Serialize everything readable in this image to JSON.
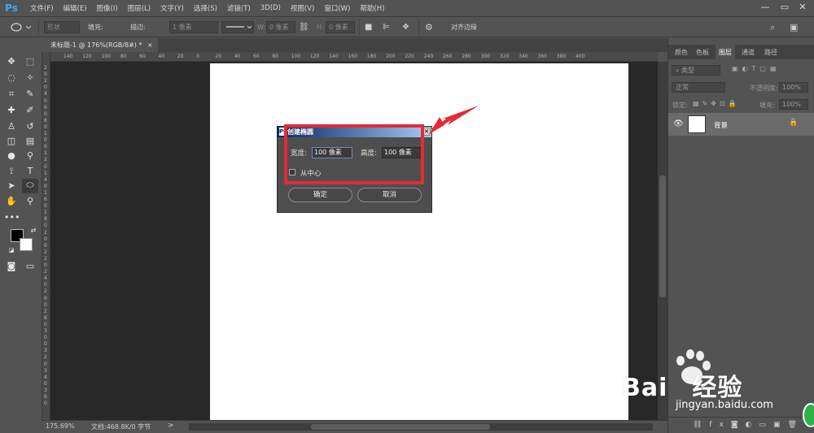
{
  "app": {
    "logo": "Ps"
  },
  "menu": [
    "文件(F)",
    "编辑(E)",
    "图像(I)",
    "图层(L)",
    "文字(Y)",
    "选择(S)",
    "滤镜(T)",
    "3D(D)",
    "视图(V)",
    "窗口(W)",
    "帮助(H)"
  ],
  "window_controls": {
    "minimize": "—",
    "restore": "▭",
    "close": "✕"
  },
  "options": {
    "mode": "形状",
    "fill_label": "填充:",
    "stroke_label": "描边:",
    "stroke_width": "1 像素",
    "w_label": "W:",
    "w_value": "0 像素",
    "h_label": "H:",
    "h_value": "0 像素",
    "align_edges": "对齐边缘"
  },
  "document": {
    "tab_title": "未标题-1 @ 176%(RGB/8#) *",
    "close_glyph": "×"
  },
  "ruler": {
    "h_ticks": [
      "140",
      "120",
      "100",
      "80",
      "60",
      "40",
      "20",
      "0",
      "20",
      "40",
      "60",
      "80",
      "100",
      "120",
      "140",
      "160",
      "180",
      "200",
      "220",
      "240",
      "260",
      "280",
      "300",
      "320",
      "340",
      "360",
      "380",
      "400"
    ],
    "v_ticks": [
      "2",
      "0",
      "2",
      "0",
      "4",
      "0",
      "6",
      "0",
      "8",
      "0",
      "1",
      "0",
      "0",
      "1",
      "2",
      "0",
      "1",
      "4",
      "0",
      "1",
      "6",
      "0",
      "1",
      "8",
      "0",
      "2",
      "0",
      "0",
      "2",
      "2",
      "0",
      "2",
      "4",
      "0",
      "2",
      "6",
      "0",
      "2",
      "8",
      "0",
      "3",
      "0",
      "0",
      "3",
      "2",
      "0",
      "3",
      "4",
      "0",
      "3",
      "6",
      "0"
    ]
  },
  "status": {
    "zoom": "175.69%",
    "doc_info": "文档:468.8K/0 字节",
    "arrow": ">"
  },
  "panel": {
    "tabs": [
      "颜色",
      "色板",
      "图层",
      "通道",
      "路径"
    ],
    "filter_label": "类型",
    "blend_mode": "正常",
    "opacity_label": "不透明度:",
    "opacity_value": "100%",
    "lock_label": "锁定:",
    "fill_label": "填充:",
    "fill_value": "100%",
    "layer_name": "背景"
  },
  "dialog": {
    "title": "创建椭圆",
    "width_label": "宽度:",
    "width_value": "100 像素",
    "height_label": "高度:",
    "height_value": "100 像素",
    "from_center_label": "从中心",
    "ok": "确定",
    "cancel": "取消"
  },
  "watermark": {
    "brand": "Bai",
    "brand2": "经验",
    "url": "jingyan.baidu.com"
  },
  "colors": {
    "accent_red": "#e52a36",
    "canvas_bg": "#282828",
    "ui_gray": "#535353",
    "ps_blue": "#3da6ff"
  }
}
